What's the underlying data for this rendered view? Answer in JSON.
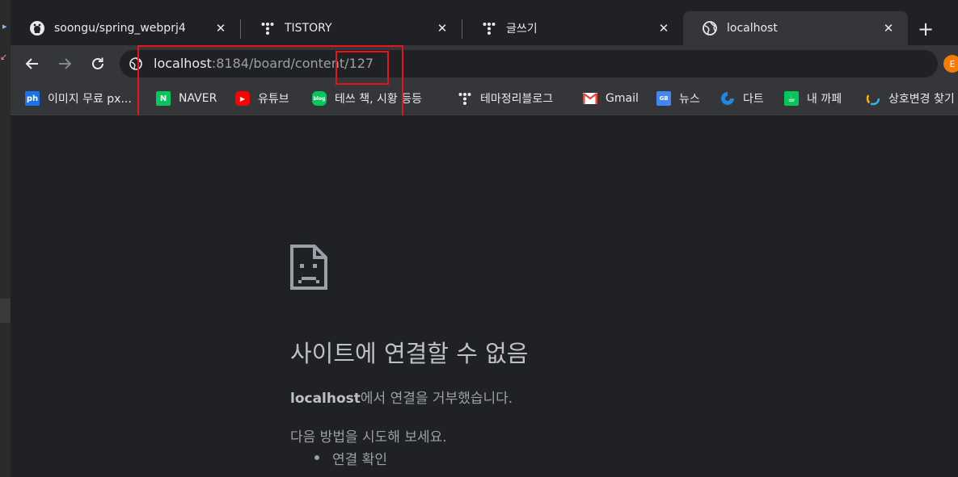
{
  "tabs": [
    {
      "title": "soongu/spring_webprj4",
      "icon": "github-icon"
    },
    {
      "title": "TISTORY",
      "icon": "tistory-icon"
    },
    {
      "title": "글쓰기",
      "icon": "tistory-icon"
    },
    {
      "title": "localhost",
      "icon": "globe-icon",
      "active": true
    }
  ],
  "address": {
    "host": "localhost",
    "rest": ":8184/board/content/127"
  },
  "extension_label": "E",
  "bookmarks": [
    {
      "label": "이미지 무료 px...",
      "icon_text": "ph",
      "color": "#1a73e8"
    },
    {
      "label": "NAVER",
      "icon_text": "N",
      "color": "#03c75a"
    },
    {
      "label": "유튜브",
      "icon_text": "▶",
      "color": "#ff0000"
    },
    {
      "label": "테쓰 책, 시황 등등",
      "icon_text": "blog",
      "color": "#03c75a"
    },
    {
      "label": "테마정리블로그",
      "icon_text": "",
      "color": ""
    },
    {
      "label": "Gmail",
      "icon_text": "M",
      "color": ""
    },
    {
      "label": "뉴스",
      "icon_text": "GB",
      "color": "#4285f4"
    },
    {
      "label": "다트",
      "icon_text": "",
      "color": "#1565c0"
    },
    {
      "label": "내 까페",
      "icon_text": "☕",
      "color": "#03c75a"
    },
    {
      "label": "상호변경 찾기",
      "icon_text": "",
      "color": ""
    }
  ],
  "error": {
    "title": "사이트에 연결할 수 없음",
    "host": "localhost",
    "desc_rest": "에서 연결을 거부했습니다.",
    "try_label": "다음 방법을 시도해 보세요.",
    "suggestions": [
      "연결 확인"
    ]
  },
  "colors": {
    "highlight": "#e8141b",
    "background": "#202124",
    "toolbar": "#35363a"
  }
}
